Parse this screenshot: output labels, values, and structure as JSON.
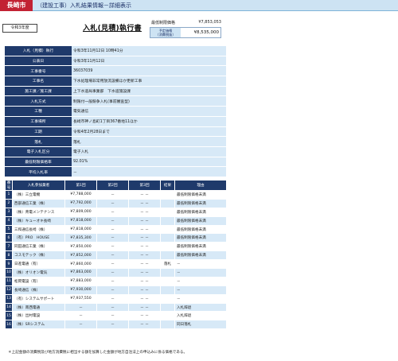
{
  "header": {
    "city": "長崎市",
    "page_title": "（建設工事）入札結果情報－詳細表示"
  },
  "year_label": "令和3年度",
  "doc_title": "入札(見積)執行書",
  "prices": {
    "min_label": "最低制限価格",
    "min_value": "¥7,853,053",
    "est_label_line1": "予定価格",
    "est_label_line2": "（消費税抜）",
    "est_value": "¥8,535,000"
  },
  "info": [
    {
      "k": "入札（見積）執行",
      "v": "令和3年11月12日 10時41分"
    },
    {
      "k": "公表日",
      "v": "令和3年11月12日"
    },
    {
      "k": "工事番号",
      "v": "36037039"
    },
    {
      "k": "工事名",
      "v": "下水処理場非常用放流設備ほか更新工事"
    },
    {
      "k": "施工課／施工課",
      "v": "上下水道局事業部　下水道施設課"
    },
    {
      "k": "入札方式",
      "v": "制限付一般競争入札(事前審査型)"
    },
    {
      "k": "工種",
      "v": "電気通信"
    },
    {
      "k": "工事場所",
      "v": "長崎市神ノ島町1丁目367番地11ほか"
    },
    {
      "k": "工期",
      "v": "令和4年2月28日まで"
    },
    {
      "k": "落札",
      "v": "落札"
    },
    {
      "k": "電子入札区分",
      "v": "電子入札"
    },
    {
      "k": "最低制限価格率",
      "v": "92.01%"
    },
    {
      "k": "平均入札率",
      "v": "－"
    }
  ],
  "bid_headers": [
    "番号",
    "入札参加業者",
    "第1回",
    "第2回",
    "第3回",
    "結果",
    "理由"
  ],
  "bids": [
    {
      "no": "1",
      "name": "（株）三立電機",
      "r1": "¥7,788,000",
      "r2": "－",
      "r3": "－ －",
      "res": "",
      "reason": "最低制限価格未満"
    },
    {
      "no": "2",
      "name": "西部通信工業（株）",
      "r1": "¥7,792,000",
      "r2": "－",
      "r3": "－ －",
      "res": "",
      "reason": "最低制限価格未満"
    },
    {
      "no": "3",
      "name": "（株）青電メンテナンス",
      "r1": "¥7,809,000",
      "r2": "－",
      "r3": "－ －",
      "res": "",
      "reason": "最低制限価格未満"
    },
    {
      "no": "4",
      "name": "（株）キューオキ長崎",
      "r1": "¥7,818,000",
      "r2": "－",
      "r3": "－ －",
      "res": "",
      "reason": "最低制限価格未満"
    },
    {
      "no": "5",
      "name": "三和通信長崎（株）",
      "r1": "¥7,818,000",
      "r2": "－",
      "r3": "－ －",
      "res": "",
      "reason": "最低制限価格未満"
    },
    {
      "no": "6",
      "name": "（有）PRO　HOUSE",
      "r1": "¥7,835,300",
      "r2": "－",
      "r3": "－ －",
      "res": "",
      "reason": "最低制限価格未満"
    },
    {
      "no": "7",
      "name": "同田通信工業（株）",
      "r1": "¥7,850,000",
      "r2": "－",
      "r3": "－ －",
      "res": "",
      "reason": "最低制限価格未満"
    },
    {
      "no": "8",
      "name": "コスモテック（株）",
      "r1": "¥7,852,000",
      "r2": "－",
      "r3": "－ －",
      "res": "",
      "reason": "最低制限価格未満"
    },
    {
      "no": "9",
      "name": "日進電通（有）",
      "r1": "¥7,860,000",
      "r2": "－",
      "r3": "－ －",
      "res": "落札",
      "reason": "－"
    },
    {
      "no": "10",
      "name": "（株）オリオン電気",
      "r1": "¥7,863,000",
      "r2": "－",
      "r3": "－ －",
      "res": "",
      "reason": "－"
    },
    {
      "no": "11",
      "name": "松岡電設（有）",
      "r1": "¥7,883,000",
      "r2": "－",
      "r3": "－ －",
      "res": "",
      "reason": "－"
    },
    {
      "no": "12",
      "name": "長崎通信（株）",
      "r1": "¥7,930,000",
      "r2": "－",
      "r3": "－ －",
      "res": "",
      "reason": "－"
    },
    {
      "no": "13",
      "name": "（有）システムサポート",
      "r1": "¥7,937,550",
      "r2": "－",
      "r3": "－ －",
      "res": "",
      "reason": "－"
    },
    {
      "no": "14",
      "name": "（株）南西電通",
      "r1": "－",
      "r2": "－",
      "r3": "－ －",
      "res": "",
      "reason": "入札辞退"
    },
    {
      "no": "15",
      "name": "（株）出村電設",
      "r1": "－",
      "r2": "－",
      "r3": "－ －",
      "res": "",
      "reason": "入札辞退"
    },
    {
      "no": "16",
      "name": "（株）SRシステム",
      "r1": "－",
      "r2": "－",
      "r3": "－ －",
      "res": "",
      "reason": "同日落札"
    }
  ],
  "footnote": "＊上記金額の消費税及び地方消費税に相当する額を加算した金額が地方自治法上の申込みに係る価格である。"
}
